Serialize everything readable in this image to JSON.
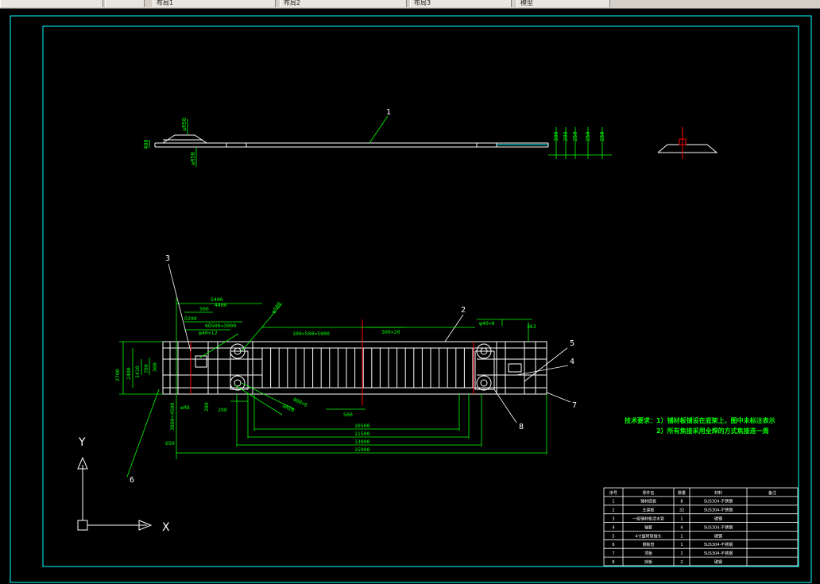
{
  "toolbar": {
    "tabs": [
      "布局1",
      "布局2",
      "布局3"
    ],
    "extra_field": "模型"
  },
  "colors": {
    "frame": "#00ffff",
    "geometry": "#ffffff",
    "dimension": "#00ff00",
    "centerline": "#ff0000",
    "notes": "#00ff00"
  },
  "labels": {
    "balloons": [
      "1",
      "2",
      "3",
      "4",
      "5",
      "6",
      "7",
      "8"
    ],
    "ucs_x": "X",
    "ucs_y": "Y"
  },
  "dims": {
    "side": [
      "≥R50",
      "400",
      "≥R50",
      "300",
      "200",
      "250",
      "250",
      "250"
    ],
    "plan_top": [
      "5400",
      "4400",
      "500",
      "Ò290",
      "6Ò500=3000",
      "φ40×12",
      "φ500",
      "100×500=5000",
      "300×20",
      "φ40×8",
      "363"
    ],
    "plan_left": [
      "2700",
      "2400",
      "1410",
      "700",
      "300"
    ],
    "plan_bottom": [
      "3800×4500",
      "650",
      "280",
      "290",
      "500",
      "10500",
      "11500",
      "13800",
      "15900",
      "480×6",
      "≥R20",
      "≥R8"
    ]
  },
  "notes": {
    "title": "技术要求：",
    "line1": "1）铺材板铺设在底架上，图中未标注表示",
    "line2": "2）所有焦接采用全焊的方式焦接连一周"
  },
  "bom": {
    "headers": [
      "序号",
      "零件名",
      "数量",
      "材料",
      "备注"
    ],
    "rows": [
      [
        "1",
        "铺材底板",
        "8",
        "SUS304-不锈钢",
        ""
      ],
      [
        "2",
        "主梁板",
        "32",
        "SUS304-不锈钢",
        ""
      ],
      [
        "3",
        "一级铺材板清水管",
        "1",
        "碳钢",
        ""
      ],
      [
        "4",
        "轴套",
        "4",
        "SUS304-不锈钢",
        ""
      ],
      [
        "5",
        "4寸旋转管接头",
        "1",
        "碳钢",
        ""
      ],
      [
        "6",
        "侧板管",
        "1",
        "SUS304-不锈钢",
        ""
      ],
      [
        "7",
        "顶板",
        "1",
        "SUS304-不锈钢",
        ""
      ],
      [
        "8",
        "挡板",
        "2",
        "碳钢",
        ""
      ]
    ]
  }
}
